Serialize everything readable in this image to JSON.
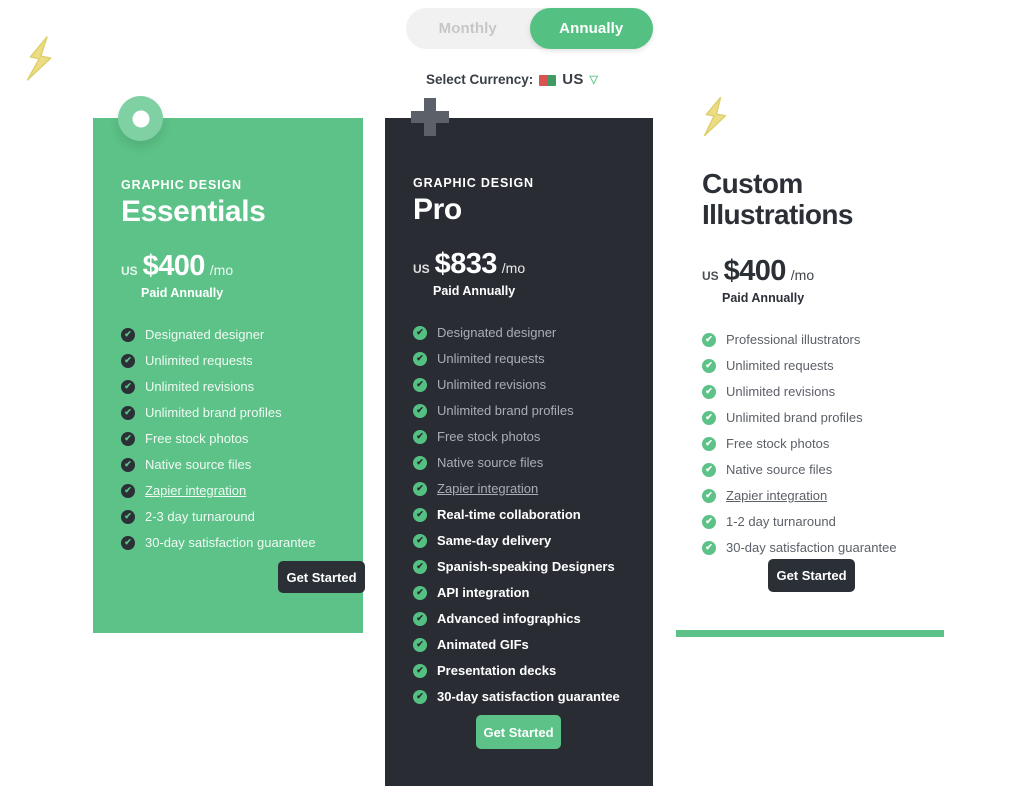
{
  "billing_toggle": {
    "options": [
      {
        "label": "Monthly",
        "active": false
      },
      {
        "label": "Annually",
        "active": true
      }
    ]
  },
  "currency": {
    "label": "Select Currency:",
    "flag_icon": "flag-icon",
    "code": "US",
    "caret_icon": "chevron-down-icon",
    "caret_glyph": "▽",
    "accent": "#6ecb94"
  },
  "decor": {
    "corner_bolt_icon": "lightning-bolt-icon",
    "ring_badge_icon": "ring-icon",
    "plus_badge_icon": "plus-icon",
    "bolt_badge_icon": "lightning-bolt-icon"
  },
  "colors": {
    "green": "#5cc287",
    "dark": "#292d33",
    "toggle_track": "#f1f1f1",
    "yellow": "#e9d87a"
  },
  "plans": [
    {
      "eyebrow": "GRAPHIC DESIGN",
      "name": "Essentials",
      "price_currency": "US",
      "price_amount": "$400",
      "price_period": "/mo",
      "paid_note": "Paid Annually",
      "cta_label": "Get Started",
      "features": [
        {
          "text": "Designated designer",
          "bold": false,
          "link": false
        },
        {
          "text": "Unlimited requests",
          "bold": false,
          "link": false
        },
        {
          "text": "Unlimited revisions",
          "bold": false,
          "link": false
        },
        {
          "text": "Unlimited brand profiles",
          "bold": false,
          "link": false
        },
        {
          "text": "Free stock photos",
          "bold": false,
          "link": false
        },
        {
          "text": "Native source files",
          "bold": false,
          "link": false
        },
        {
          "text": "Zapier integration",
          "bold": false,
          "link": true
        },
        {
          "text": "2-3 day turnaround",
          "bold": false,
          "link": false
        },
        {
          "text": "30-day satisfaction guarantee",
          "bold": false,
          "link": false
        }
      ]
    },
    {
      "eyebrow": "GRAPHIC DESIGN",
      "name": "Pro",
      "price_currency": "US",
      "price_amount": "$833",
      "price_period": "/mo",
      "paid_note": "Paid Annually",
      "cta_label": "Get Started",
      "features": [
        {
          "text": "Designated designer",
          "bold": false,
          "link": false
        },
        {
          "text": "Unlimited requests",
          "bold": false,
          "link": false
        },
        {
          "text": "Unlimited revisions",
          "bold": false,
          "link": false
        },
        {
          "text": "Unlimited brand profiles",
          "bold": false,
          "link": false
        },
        {
          "text": "Free stock photos",
          "bold": false,
          "link": false
        },
        {
          "text": "Native source files",
          "bold": false,
          "link": false
        },
        {
          "text": "Zapier integration",
          "bold": false,
          "link": true
        },
        {
          "text": "Real-time collaboration",
          "bold": true,
          "link": false
        },
        {
          "text": "Same-day delivery",
          "bold": true,
          "link": false
        },
        {
          "text": "Spanish-speaking Designers",
          "bold": true,
          "link": false
        },
        {
          "text": "API integration",
          "bold": true,
          "link": false
        },
        {
          "text": "Advanced infographics",
          "bold": true,
          "link": false
        },
        {
          "text": "Animated GIFs",
          "bold": true,
          "link": false
        },
        {
          "text": "Presentation decks",
          "bold": true,
          "link": false
        },
        {
          "text": "30-day satisfaction guarantee",
          "bold": true,
          "link": false
        }
      ]
    },
    {
      "eyebrow": "",
      "name": "Custom\nIllustrations",
      "price_currency": "US",
      "price_amount": "$400",
      "price_period": "/mo",
      "paid_note": "Paid Annually",
      "cta_label": "Get Started",
      "features": [
        {
          "text": "Professional illustrators",
          "bold": false,
          "link": false
        },
        {
          "text": "Unlimited requests",
          "bold": false,
          "link": false
        },
        {
          "text": "Unlimited revisions",
          "bold": false,
          "link": false
        },
        {
          "text": "Unlimited brand profiles",
          "bold": false,
          "link": false
        },
        {
          "text": "Free stock photos",
          "bold": false,
          "link": false
        },
        {
          "text": "Native source files",
          "bold": false,
          "link": false
        },
        {
          "text": "Zapier integration",
          "bold": false,
          "link": true
        },
        {
          "text": "1-2 day turnaround",
          "bold": false,
          "link": false
        },
        {
          "text": "30-day satisfaction guarantee",
          "bold": false,
          "link": false
        }
      ]
    }
  ]
}
